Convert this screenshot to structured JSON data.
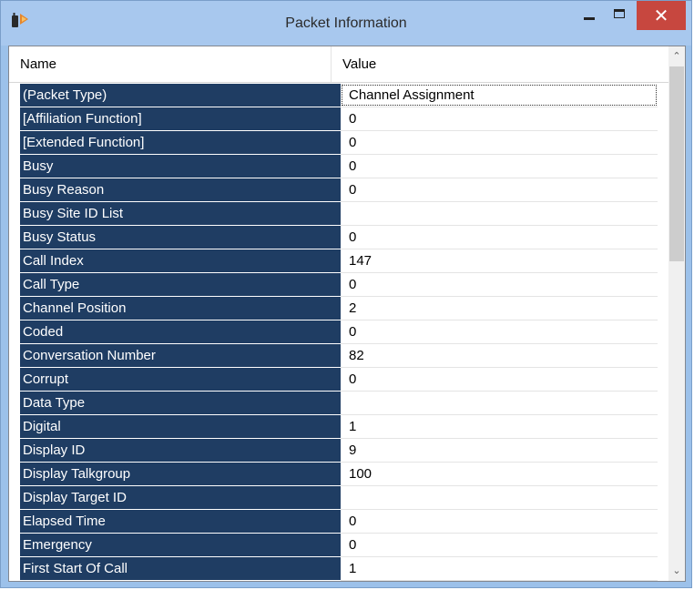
{
  "window": {
    "title": "Packet Information",
    "close_glyph": "✕"
  },
  "icons": {
    "app": "app-icon",
    "minimize": "minimize-icon",
    "maximize": "maximize-icon",
    "close": "close-icon"
  },
  "table": {
    "columns": [
      "Name",
      "Value"
    ],
    "rows": [
      {
        "name": "(Packet Type)",
        "value": "Channel Assignment"
      },
      {
        "name": "[Affiliation Function]",
        "value": "0"
      },
      {
        "name": "[Extended Function]",
        "value": "0"
      },
      {
        "name": "Busy",
        "value": "0"
      },
      {
        "name": "Busy Reason",
        "value": "0"
      },
      {
        "name": "Busy Site ID List",
        "value": ""
      },
      {
        "name": "Busy Status",
        "value": "0"
      },
      {
        "name": "Call Index",
        "value": "147"
      },
      {
        "name": "Call Type",
        "value": "0"
      },
      {
        "name": "Channel Position",
        "value": "2"
      },
      {
        "name": "Coded",
        "value": "0"
      },
      {
        "name": "Conversation Number",
        "value": "82"
      },
      {
        "name": "Corrupt",
        "value": "0"
      },
      {
        "name": "Data Type",
        "value": ""
      },
      {
        "name": "Digital",
        "value": "1"
      },
      {
        "name": "Display ID",
        "value": "9"
      },
      {
        "name": "Display Talkgroup",
        "value": "100"
      },
      {
        "name": "Display Target ID",
        "value": ""
      },
      {
        "name": "Elapsed Time",
        "value": "0"
      },
      {
        "name": "Emergency",
        "value": "0"
      },
      {
        "name": "First Start Of Call",
        "value": "1"
      }
    ]
  },
  "scrollbar": {
    "up_glyph": "⌃",
    "down_glyph": "⌄"
  },
  "colors": {
    "titlebar": "#a8c8ee",
    "name_cell_bg": "#1f3d63",
    "close_button": "#c7473f"
  }
}
